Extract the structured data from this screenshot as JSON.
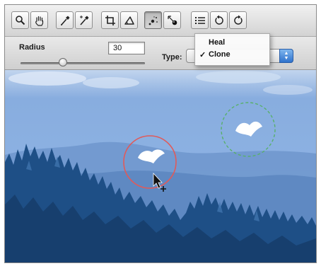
{
  "options": {
    "radius_label": "Radius",
    "radius_value": "30",
    "radius_slider_fraction": 0.34,
    "type_label": "Type:"
  },
  "type_menu": {
    "items": [
      {
        "label": "Heal",
        "checked": false,
        "check": ""
      },
      {
        "label": "Clone",
        "checked": true,
        "check": "✓"
      }
    ]
  },
  "toolbar": {
    "tools": [
      "zoom-icon",
      "hand-icon",
      "white-balance-eyedropper-icon",
      "color-sampler-icon",
      "crop-icon",
      "straighten-icon",
      "retouch-icon",
      "red-eye-icon",
      "list-icon",
      "rotate-left-icon",
      "rotate-right-icon"
    ],
    "active_tool": "retouch-icon"
  },
  "canvas": {
    "target_circle_color": "#e05a5a",
    "source_circle_color": "#58b06a",
    "sky_color": "#8db2e3",
    "tree_color": "#1e4f86"
  }
}
